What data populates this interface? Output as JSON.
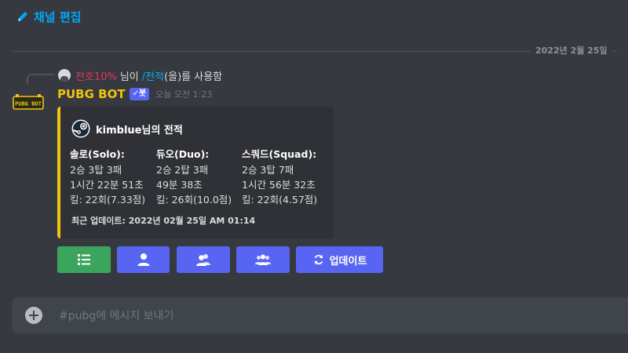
{
  "channel": {
    "title": "채널 편집",
    "icon": "pencil-icon"
  },
  "date_divider": "2022년 2월 25일",
  "reply": {
    "username": "전호10%",
    "suffix": "님이",
    "command": "/전적",
    "action": "(을)를 사용함"
  },
  "message": {
    "avatar_text": "PUBG BOT",
    "author": "PUBG BOT",
    "bot_tag": "✓봇",
    "timestamp": "오늘 오전 1:23"
  },
  "embed": {
    "author_name": "kimblue님의 전적",
    "author_icon": "steam-icon",
    "fields": [
      {
        "name": "솔로(Solo):",
        "lines": [
          "2승 3탑 3패",
          "1시간 22분 51초",
          "킬: 22회(7.33점)"
        ]
      },
      {
        "name": "듀오(Duo):",
        "lines": [
          "2승 2탑 3패",
          "49분 38초",
          "킬: 26회(10.0점)"
        ]
      },
      {
        "name": "스쿼드(Squad):",
        "lines": [
          "2승 3탑 7패",
          "1시간 56분 32초",
          "킬: 22회(4.57점)"
        ]
      }
    ],
    "footer": "최근 업데이트: 2022년 02월 25일 AM 01:14"
  },
  "buttons": [
    {
      "icon": "list-icon",
      "color": "#3ba55d"
    },
    {
      "icon": "user-icon",
      "color": "#5865f2"
    },
    {
      "icon": "users-duo-icon",
      "color": "#5865f2"
    },
    {
      "icon": "users-squad-icon",
      "color": "#5865f2"
    },
    {
      "icon": "refresh-icon",
      "label": "업데이트",
      "color": "#5865f2"
    }
  ],
  "composer": {
    "placeholder": "#pubg에 메시지 보내기",
    "value": ""
  },
  "colors": {
    "background": "#36393f",
    "accent": "#5865f2",
    "embed_bar": "#f1c40f",
    "author": "#f1c40f",
    "link": "#00b0f4"
  }
}
